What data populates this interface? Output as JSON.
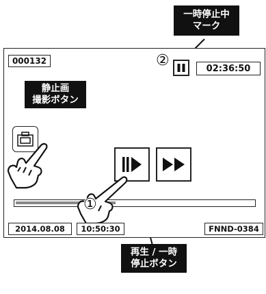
{
  "callouts": {
    "pause_mark": {
      "line1": "一時停止中",
      "line2": "マーク"
    },
    "still_button": {
      "line1": "静止画",
      "line2": "撮影ボタン"
    },
    "play_pause_button": {
      "line1": "再生 / 一時",
      "line2": "停止ボタン"
    }
  },
  "screen": {
    "counter": "000132",
    "time_display": "02:36:50",
    "date": "2014.08.08",
    "clock": "10:50:30",
    "file_id": "FNND-0384",
    "progress": 0.42
  },
  "markers": {
    "one": "①",
    "two": "②"
  },
  "icons": {
    "pause": "pause-icon",
    "camera": "camera-icon",
    "play_pause": "play-pause-icon",
    "fast_forward": "fast-forward-icon",
    "hand_camera": "pointing-hand-icon",
    "hand_play": "pointing-hand-icon"
  }
}
